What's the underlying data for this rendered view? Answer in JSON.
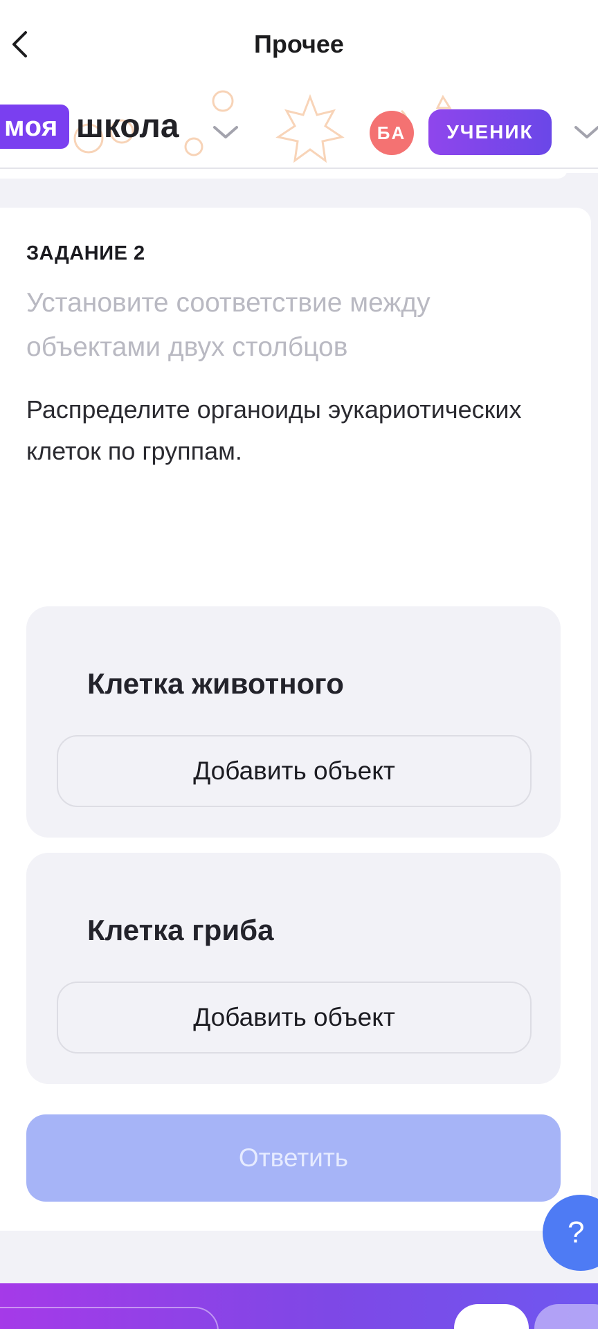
{
  "header": {
    "title": "Прочее",
    "back_icon": "chevron-left-icon"
  },
  "brand": {
    "logo_box": "моя",
    "logo_text": "школа"
  },
  "user": {
    "initials": "БА",
    "role": "УЧЕНИК"
  },
  "task": {
    "label": "ЗАДАНИЕ 2",
    "subtitle": "Установите соответствие между объектами двух столбцов",
    "text": "Распределите органоиды эукариотических клеток по группам."
  },
  "groups": [
    {
      "title": "Клетка животного",
      "add_label": "Добавить объект"
    },
    {
      "title": "Клетка гриба",
      "add_label": "Добавить объект"
    }
  ],
  "actions": {
    "answer_label": "Ответить",
    "help_label": "?"
  },
  "colors": {
    "accent": "#7a3ff0",
    "avatar": "#f47272",
    "answer_disabled": "#a6b4f7",
    "help": "#4e7bf4"
  }
}
